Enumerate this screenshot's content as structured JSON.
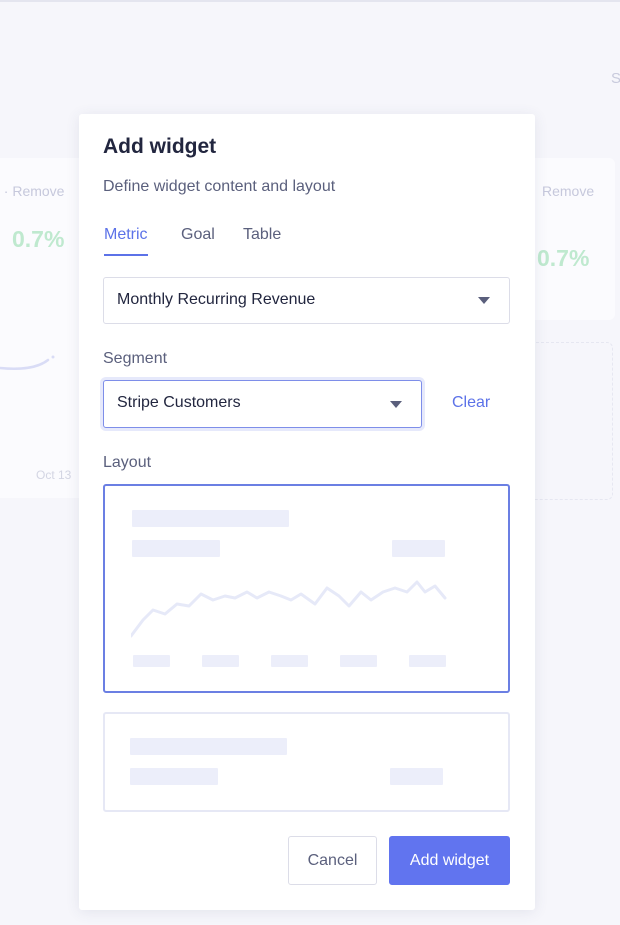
{
  "background": {
    "remove_left": "t · Remove",
    "remove_right": "Remove",
    "percent": "0.7%",
    "date": "Oct 13",
    "s_letter": "S"
  },
  "modal": {
    "title": "Add widget",
    "subtitle": "Define widget content and layout",
    "tabs": [
      {
        "label": "Metric",
        "active": true
      },
      {
        "label": "Goal",
        "active": false
      },
      {
        "label": "Table",
        "active": false
      }
    ],
    "metric_select": {
      "value": "Monthly Recurring Revenue",
      "icon": "chevron-down-icon"
    },
    "segment": {
      "label": "Segment",
      "value": "Stripe Customers",
      "icon": "chevron-down-icon",
      "clear_label": "Clear"
    },
    "layout": {
      "label": "Layout",
      "options": [
        {
          "kind": "chart-with-sparkline",
          "selected": true
        },
        {
          "kind": "number-only",
          "selected": false
        }
      ]
    },
    "buttons": {
      "cancel_label": "Cancel",
      "add_label": "Add widget"
    }
  },
  "colors": {
    "accent": "#5c72e8",
    "primary_button": "#6174ef",
    "positive": "#bfe9cf",
    "placeholder": "#eceefa"
  }
}
